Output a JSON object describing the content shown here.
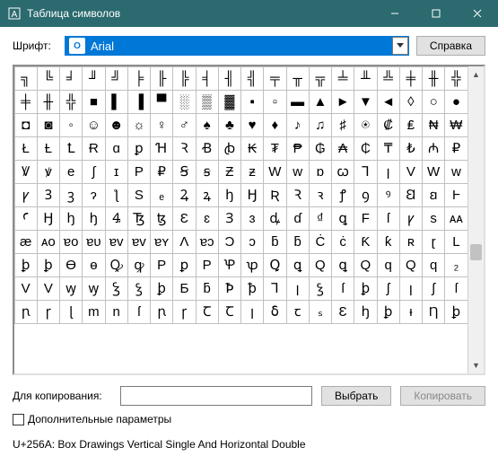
{
  "window_title": "Таблица символов",
  "font_label": "Шрифт:",
  "font_name": "Arial",
  "help_btn": "Справка",
  "copy_label": "Для копирования:",
  "copy_value": "",
  "select_btn": "Выбрать",
  "copy_btn": "Копировать",
  "advanced_label": "Дополнительные параметры",
  "status": "U+256A: Box Drawings Vertical Single And Horizontal Double",
  "font_icon": "O",
  "grid": [
    [
      "╗",
      "╚",
      "╛",
      "╜",
      "╝",
      "╞",
      "╟",
      "╠",
      "╡",
      "╢",
      "╣",
      "╤",
      "╥",
      "╦",
      "╧",
      "╨",
      "╩",
      "╪",
      "╫",
      "╬"
    ],
    [
      "╪",
      "╫",
      "╬",
      "■",
      "▌",
      "▐",
      "▀",
      "░",
      "▒",
      "▓",
      "▪",
      "▫",
      "▬",
      "▲",
      "►",
      "▼",
      "◄",
      "◊",
      "○",
      "●"
    ],
    [
      "◘",
      "◙",
      "◦",
      "☺",
      "☻",
      "☼",
      "♀",
      "♂",
      "♠",
      "♣",
      "♥",
      "♦",
      "♪",
      "♫",
      "♯",
      "⍟",
      "₡",
      "₤",
      "₦",
      "₩"
    ],
    [
      "Ł",
      "Ƚ",
      "Ꝉ",
      "Ɍ",
      "ɑ",
      "ꝑ",
      "Ɦ",
      "Ꝛ",
      "Ꞗ",
      "ꞗ",
      "₭",
      "₮",
      "₱",
      "₲",
      "₳",
      "₵",
      "₸",
      "₺",
      "₼",
      "₽"
    ],
    [
      "Ꝟ",
      "ꝟ",
      "e",
      "∫",
      "ɪ",
      "P",
      "₽",
      "Ꞩ",
      "ꞩ",
      "Ƶ",
      "ƶ",
      "W",
      "w",
      "ɒ",
      "ꞷ",
      "Ꞁ",
      "ꞁ",
      "V",
      "W",
      "w"
    ],
    [
      "ꝩ",
      "Ꝫ",
      "ꝫ",
      "ɂ",
      "ƪ",
      "S",
      "ₑ",
      "Ꝝ",
      "ꝝ",
      "ꜧ",
      "Ꜧ",
      "Ʀ",
      "Ꝛ",
      "ꝛ",
      "ꝭ",
      "ꝯ",
      "ꝰ",
      "Ꞛ",
      "ꞛ",
      "Ⱶ"
    ],
    [
      "Ꜥ",
      "Ꜧ",
      "ꜧ",
      "ꜧ",
      "Ꜯ",
      "Ꜩ",
      "ꜩ",
      "Ɛ",
      "ɛ",
      "Ɜ",
      "ɜ",
      "ꝱ",
      "ɗ",
      "₫",
      "ꝗ",
      "F",
      "ſ",
      "ꝩ",
      "s",
      "ᴀᴀ"
    ],
    [
      "æ",
      "ᴀᴏ",
      "ɐᴏ",
      "ɐᴜ",
      "ɐᴠ",
      "ɐv",
      "ɐʏ",
      "Ʌ",
      "ɐɔ",
      "Ɔ",
      "ɔ",
      "ƃ",
      "ƃ",
      "Ċ",
      "ċ",
      "Ƙ",
      "ƙ",
      "ʀ",
      "ɽ",
      "L"
    ],
    [
      "ꝧ",
      "ꝧ",
      "Ɵ",
      "ɵ",
      "Ꝙ",
      "ꝙ",
      "P",
      "ꝑ",
      "P",
      "Ꝕ",
      "ꝕ",
      "Ꝗ",
      "ꝗ",
      "Q",
      "ꝗ",
      "Q",
      "q",
      "Q",
      "q",
      "₂"
    ],
    [
      "V",
      "V",
      "ꝡ",
      "ꝡ",
      "Ꝣ",
      "ꝣ",
      "ꝧ",
      "Ƃ",
      "ƃ",
      "Ꝥ",
      "ꝥ",
      "Ꞁ",
      "ꞁ",
      "ꝣ",
      "ſ",
      "ꝧ",
      "ʃ",
      "ꞁ",
      "ʃ",
      "ſ"
    ],
    [
      "ꞃ",
      "ꞅ",
      "ɭ",
      "m",
      "n",
      "ſ",
      "ꞃ",
      "ꞅ",
      "Ꞇ",
      "Ꞇ",
      "ꞁ",
      "ẟ",
      "ꞇ",
      "ₛ",
      "Ɛ",
      "ꜧ",
      "ꝧ",
      "ᵻ",
      "Ƞ",
      "ꝧ"
    ]
  ]
}
